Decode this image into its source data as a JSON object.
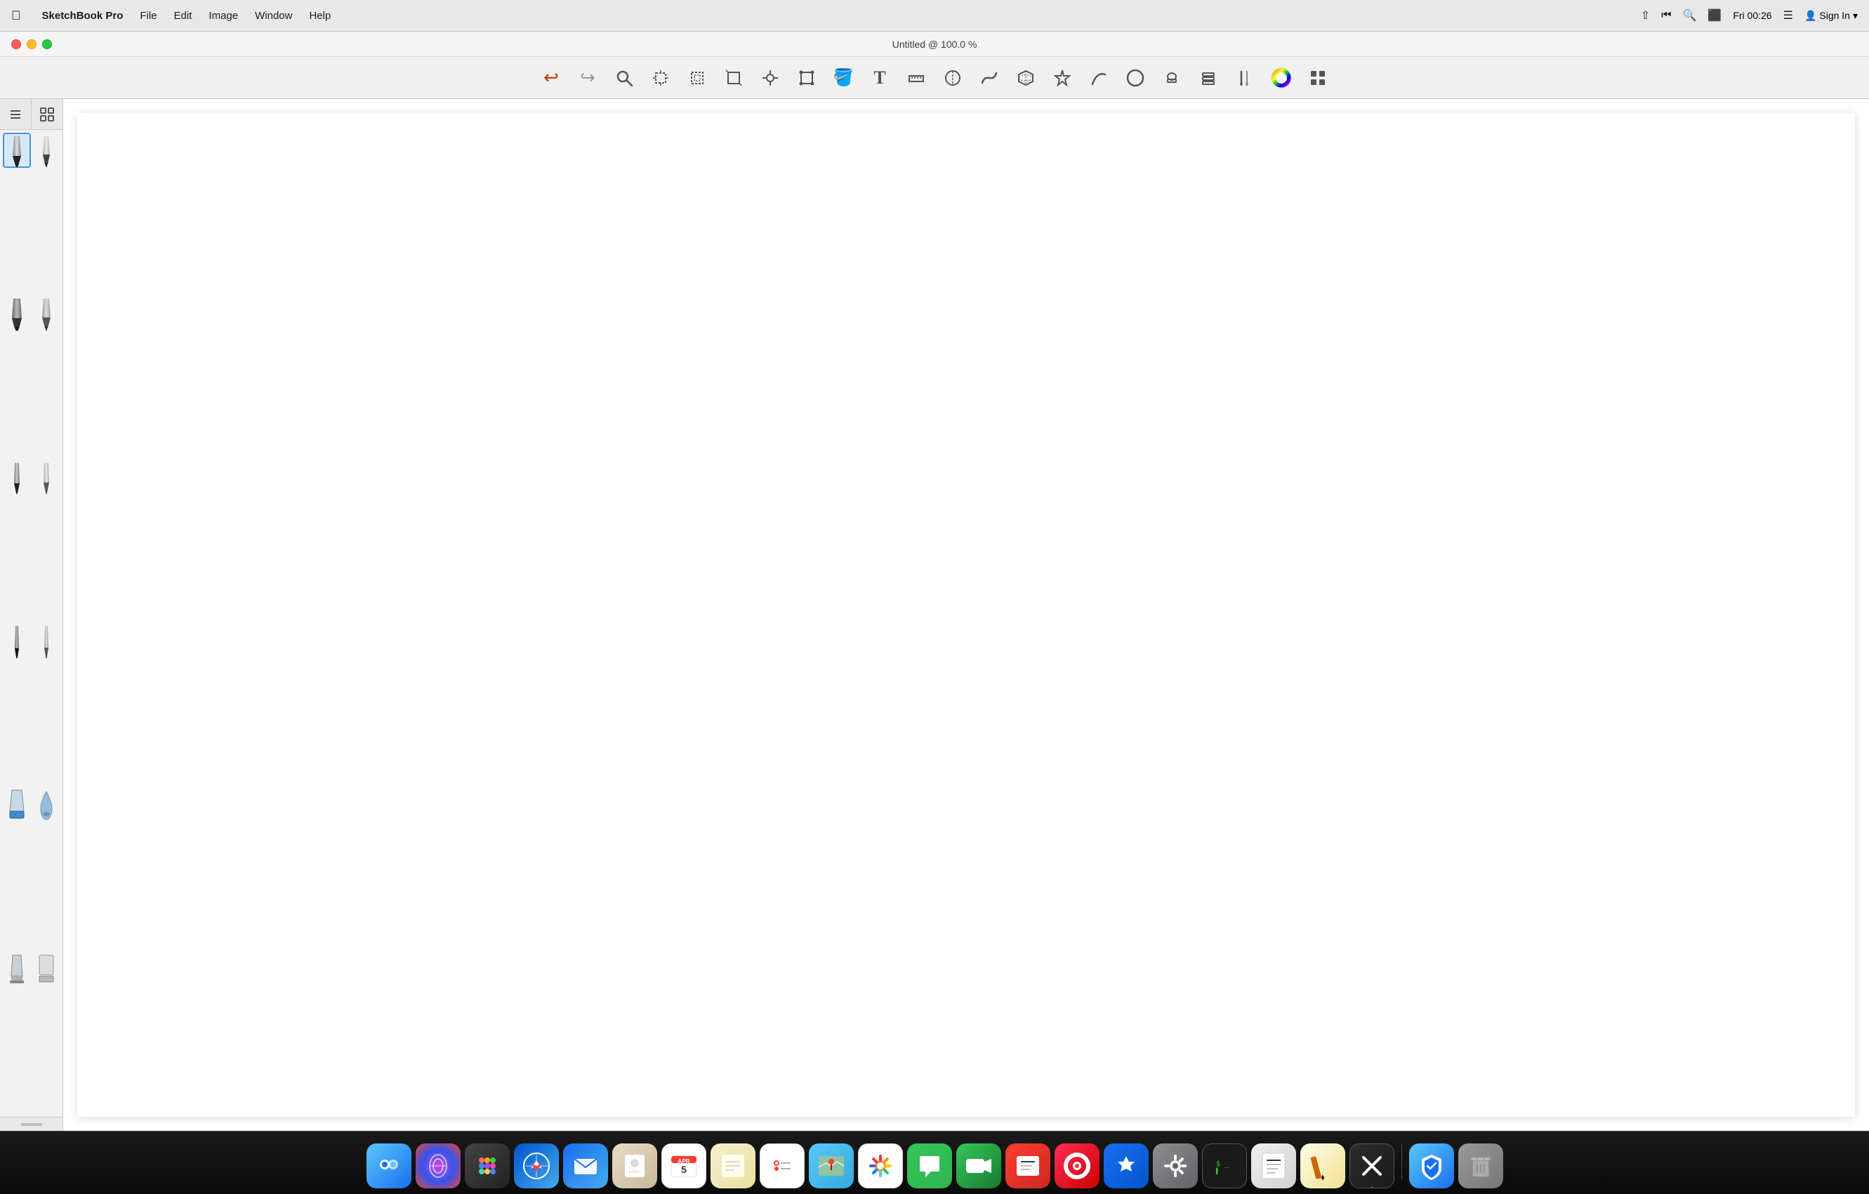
{
  "menubar": {
    "apple_label": "",
    "app_name": "SketchBook Pro",
    "menus": [
      "File",
      "Edit",
      "Image",
      "Window",
      "Help"
    ],
    "time": "Fri 00:26",
    "sign_in": "Sign In"
  },
  "titlebar": {
    "title": "Untitled @ 100.0 %"
  },
  "toolbar": {
    "tools": [
      {
        "name": "undo",
        "label": "↩",
        "semantic": "undo-button"
      },
      {
        "name": "redo",
        "label": "↪",
        "semantic": "redo-button"
      },
      {
        "name": "zoom",
        "label": "🔍",
        "semantic": "zoom-button"
      },
      {
        "name": "select-rect",
        "label": "⊹",
        "semantic": "select-rect-button"
      },
      {
        "name": "select-lasso",
        "label": "⬚",
        "semantic": "select-lasso-button"
      },
      {
        "name": "crop",
        "label": "⊡",
        "semantic": "crop-button"
      },
      {
        "name": "transform",
        "label": "⊕",
        "semantic": "transform-button"
      },
      {
        "name": "distort",
        "label": "◻",
        "semantic": "distort-button"
      },
      {
        "name": "fill",
        "label": "🪣",
        "semantic": "fill-button"
      },
      {
        "name": "text",
        "label": "T",
        "semantic": "text-button"
      },
      {
        "name": "ruler",
        "label": "📐",
        "semantic": "ruler-button"
      },
      {
        "name": "symmetry",
        "label": "⬡",
        "semantic": "symmetry-button"
      },
      {
        "name": "curve",
        "label": "𝒮",
        "semantic": "curve-button"
      },
      {
        "name": "3d",
        "label": "⬡",
        "semantic": "3d-button"
      },
      {
        "name": "magic-select",
        "label": "✵",
        "semantic": "magic-select-button"
      },
      {
        "name": "stroke",
        "label": "∫",
        "semantic": "stroke-button"
      },
      {
        "name": "ellipse",
        "label": "○",
        "semantic": "ellipse-button"
      },
      {
        "name": "stamp",
        "label": "⬭",
        "semantic": "stamp-button"
      },
      {
        "name": "layers",
        "label": "⧉",
        "semantic": "layers-button"
      },
      {
        "name": "brushes",
        "label": "✒",
        "semantic": "brushes-button"
      },
      {
        "name": "color-wheel",
        "label": "◉",
        "semantic": "color-wheel-button"
      },
      {
        "name": "brush-library",
        "label": "⬛",
        "semantic": "brush-library-button"
      }
    ]
  },
  "brush_panel": {
    "tabs": [
      {
        "label": "≡",
        "name": "list-view-tab"
      },
      {
        "label": "⊞",
        "name": "grid-view-tab"
      }
    ],
    "brushes": [
      {
        "name": "brush-1",
        "selected": true,
        "type": "pencil-dark"
      },
      {
        "name": "brush-2",
        "selected": false,
        "type": "pencil-light"
      },
      {
        "name": "brush-3",
        "selected": false,
        "type": "marker-dark"
      },
      {
        "name": "brush-4",
        "selected": false,
        "type": "marker-light"
      },
      {
        "name": "brush-5",
        "selected": false,
        "type": "pen-fine-dark"
      },
      {
        "name": "brush-6",
        "selected": false,
        "type": "pen-fine-light"
      },
      {
        "name": "brush-7",
        "selected": false,
        "type": "pen-thin-dark"
      },
      {
        "name": "brush-8",
        "selected": false,
        "type": "pen-thin-light"
      },
      {
        "name": "brush-9",
        "selected": false,
        "type": "brush-flat"
      },
      {
        "name": "brush-10",
        "selected": false,
        "type": "brush-drop"
      },
      {
        "name": "brush-11",
        "selected": false,
        "type": "eraser-flat"
      },
      {
        "name": "brush-12",
        "selected": false,
        "type": "eraser-rect"
      }
    ]
  },
  "canvas": {
    "title": "Untitled @ 100.0 %"
  },
  "dock": {
    "items": [
      {
        "name": "finder",
        "label": "🖥",
        "class": "dock-finder",
        "has_dot": true
      },
      {
        "name": "siri",
        "label": "◉",
        "class": "dock-siri",
        "has_dot": false
      },
      {
        "name": "launchpad",
        "label": "🚀",
        "class": "dock-launchpad",
        "has_dot": false
      },
      {
        "name": "safari",
        "label": "🧭",
        "class": "dock-safari",
        "has_dot": false
      },
      {
        "name": "mail",
        "label": "✉",
        "class": "dock-mail",
        "has_dot": false
      },
      {
        "name": "contacts",
        "label": "📒",
        "class": "dock-contacts",
        "has_dot": false
      },
      {
        "name": "calendar",
        "label": "📅",
        "class": "dock-calendar",
        "has_dot": false
      },
      {
        "name": "notes",
        "label": "📝",
        "class": "dock-notes",
        "has_dot": false
      },
      {
        "name": "reminders",
        "label": "☑",
        "class": "dock-reminders",
        "has_dot": false
      },
      {
        "name": "maps",
        "label": "🗺",
        "class": "dock-maps",
        "has_dot": false
      },
      {
        "name": "photos",
        "label": "🌸",
        "class": "dock-photos",
        "has_dot": false
      },
      {
        "name": "messages",
        "label": "💬",
        "class": "dock-messages",
        "has_dot": false
      },
      {
        "name": "facetime",
        "label": "📹",
        "class": "dock-facetime",
        "has_dot": false
      },
      {
        "name": "news",
        "label": "📰",
        "class": "dock-news",
        "has_dot": false
      },
      {
        "name": "music",
        "label": "♫",
        "class": "dock-music",
        "has_dot": false
      },
      {
        "name": "appstore",
        "label": "A",
        "class": "dock-appstore",
        "has_dot": false
      },
      {
        "name": "syspreferences",
        "label": "⚙",
        "class": "dock-syspreferences",
        "has_dot": false
      },
      {
        "name": "terminal",
        "label": "$",
        "class": "dock-terminal",
        "has_dot": false
      },
      {
        "name": "textedit",
        "label": "📄",
        "class": "dock-textedit",
        "has_dot": false
      },
      {
        "name": "grapher",
        "label": "✏",
        "class": "dock-grapher",
        "has_dot": false
      },
      {
        "name": "sketchbook",
        "label": "✕",
        "class": "dock-sketch",
        "has_dot": true
      },
      {
        "name": "adguard",
        "label": "◎",
        "class": "dock-adguard",
        "has_dot": false
      },
      {
        "name": "trash",
        "label": "🗑",
        "class": "dock-trash",
        "has_dot": false
      }
    ],
    "separator_after": 21
  }
}
